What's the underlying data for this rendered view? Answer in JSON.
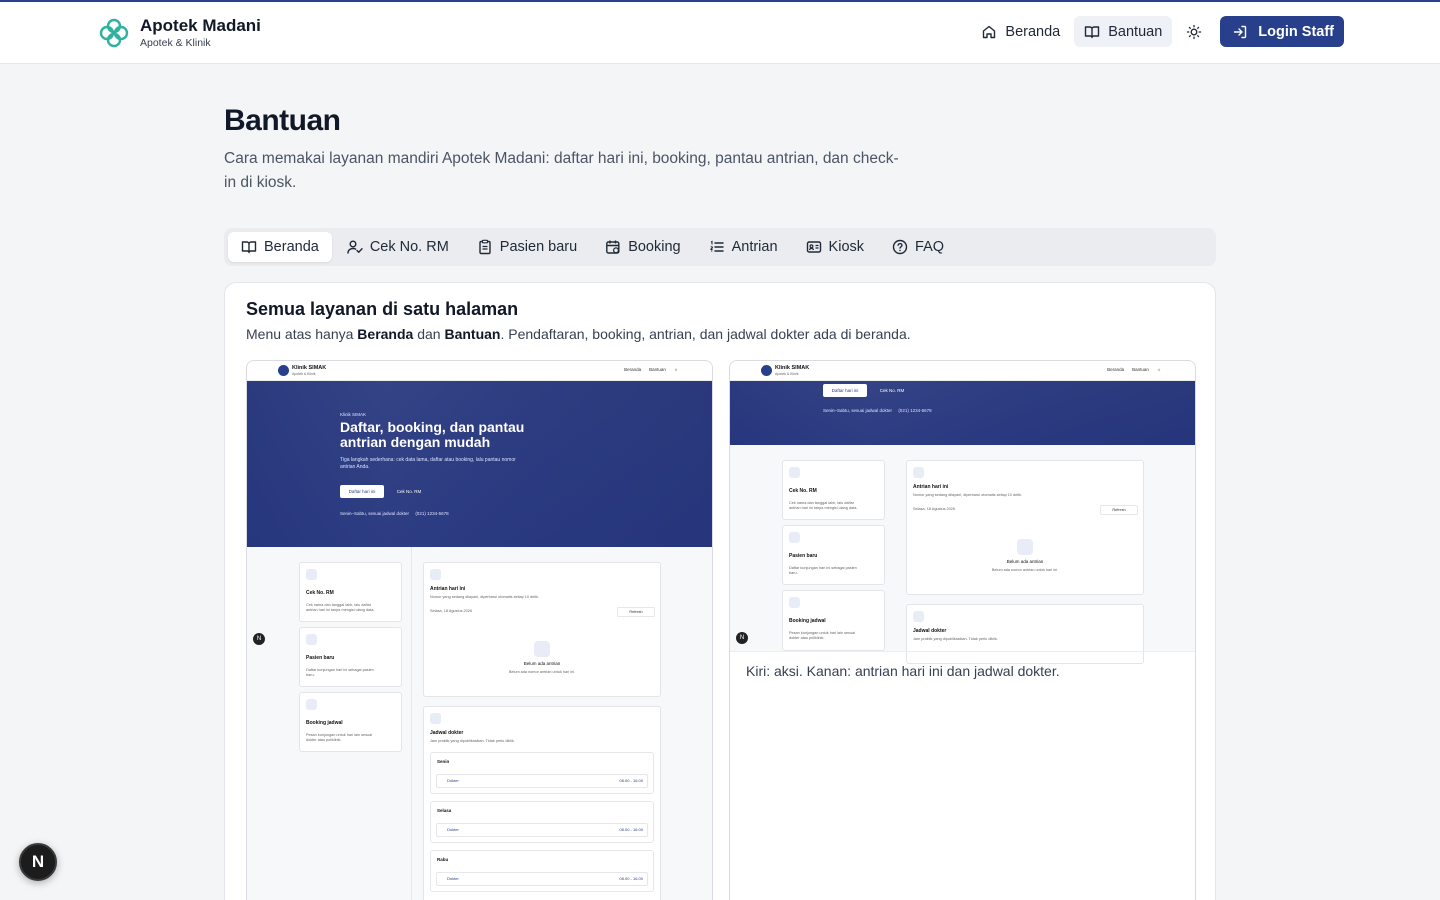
{
  "brand": {
    "name": "Apotek Madani",
    "subtitle": "Apotek & Klinik"
  },
  "nav": {
    "home_label": "Beranda",
    "help_label": "Bantuan",
    "login_label": "Login Staff"
  },
  "page": {
    "title": "Bantuan",
    "description": "Cara memakai layanan mandiri Apotek Madani: daftar hari ini, booking, pantau antrian, dan check-in di kiosk."
  },
  "tabs": [
    "Beranda",
    "Cek No. RM",
    "Pasien baru",
    "Booking",
    "Antrian",
    "Kiosk",
    "FAQ"
  ],
  "card": {
    "title": "Semua layanan di satu halaman",
    "desc_prefix": "Menu atas hanya ",
    "desc_bold1": "Beranda",
    "desc_mid": " dan ",
    "desc_bold2": "Bantuan",
    "desc_suffix": ". Pendaftaran, booking, antrian, dan jadwal dokter ada di beranda.",
    "caption": "Kiri: aksi. Kanan: antrian hari ini dan jadwal dokter."
  },
  "mini": {
    "brand": "Klinik SIMAK",
    "brand_sub": "Apotek & Klinik",
    "nav_home": "Beranda",
    "nav_help": "Bantuan",
    "hero_badge": "Klinik SIMAK",
    "hero_title": "Daftar, booking, dan pantau antrian dengan mudah",
    "hero_sub": "Tiga langkah sederhana: cek data lama, daftar atau booking, lalu pantau nomor antrian Anda.",
    "btn_register": "Daftar hari ini",
    "btn_check": "Cek No. RM",
    "hours": "Senin–Sabtu, sesuai jadwal dokter",
    "phone": "(021) 1234-5678",
    "cards": [
      {
        "title": "Cek No. RM",
        "desc": "Cek nama dan tanggal lahir, lalu daftar antrian hari ini tanpa mengisi ulang data."
      },
      {
        "title": "Pasien baru",
        "desc": "Daftar kunjungan hari ini sebagai pasien baru."
      },
      {
        "title": "Booking jadwal",
        "desc": "Pesan kunjungan untuk hari lain sesuai dokter atau poliklinik."
      }
    ],
    "queue_title": "Antrian hari ini",
    "queue_desc": "Nomor yang sedang dilayani, diperbarui otomatis setiap 10 detik.",
    "queue_date": "Selasa, 18 Agustus 2026",
    "refresh": "Refresh",
    "queue_empty": "Belum ada antrian",
    "queue_empty_desc": "Belum ada nomor antrian untuk hari ini.",
    "schedule_title": "Jadwal dokter",
    "schedule_desc": "Jam praktik yang dipublikasikan. Tidak perlu diklik.",
    "days": [
      "Senin",
      "Selasa",
      "Rabu"
    ],
    "doctor": "Dokter",
    "time": "08.00 - 16.00"
  },
  "dev_badge": "N"
}
